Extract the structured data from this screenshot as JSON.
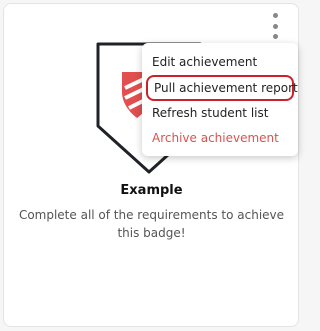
{
  "badge": {
    "title": "Example",
    "description": "Complete all of the requirements to achieve this badge!"
  },
  "menu": {
    "items": [
      {
        "label": "Edit achievement"
      },
      {
        "label": "Pull achievement report"
      },
      {
        "label": "Refresh student list"
      },
      {
        "label": "Archive achievement"
      }
    ]
  },
  "colors": {
    "accent": "#c9222a",
    "danger": "#d9534f",
    "badge_outline": "#1f2328",
    "badge_emblem": "#e14f4f"
  },
  "icons": [
    "more-vertical-icon",
    "shield-badge-icon"
  ]
}
